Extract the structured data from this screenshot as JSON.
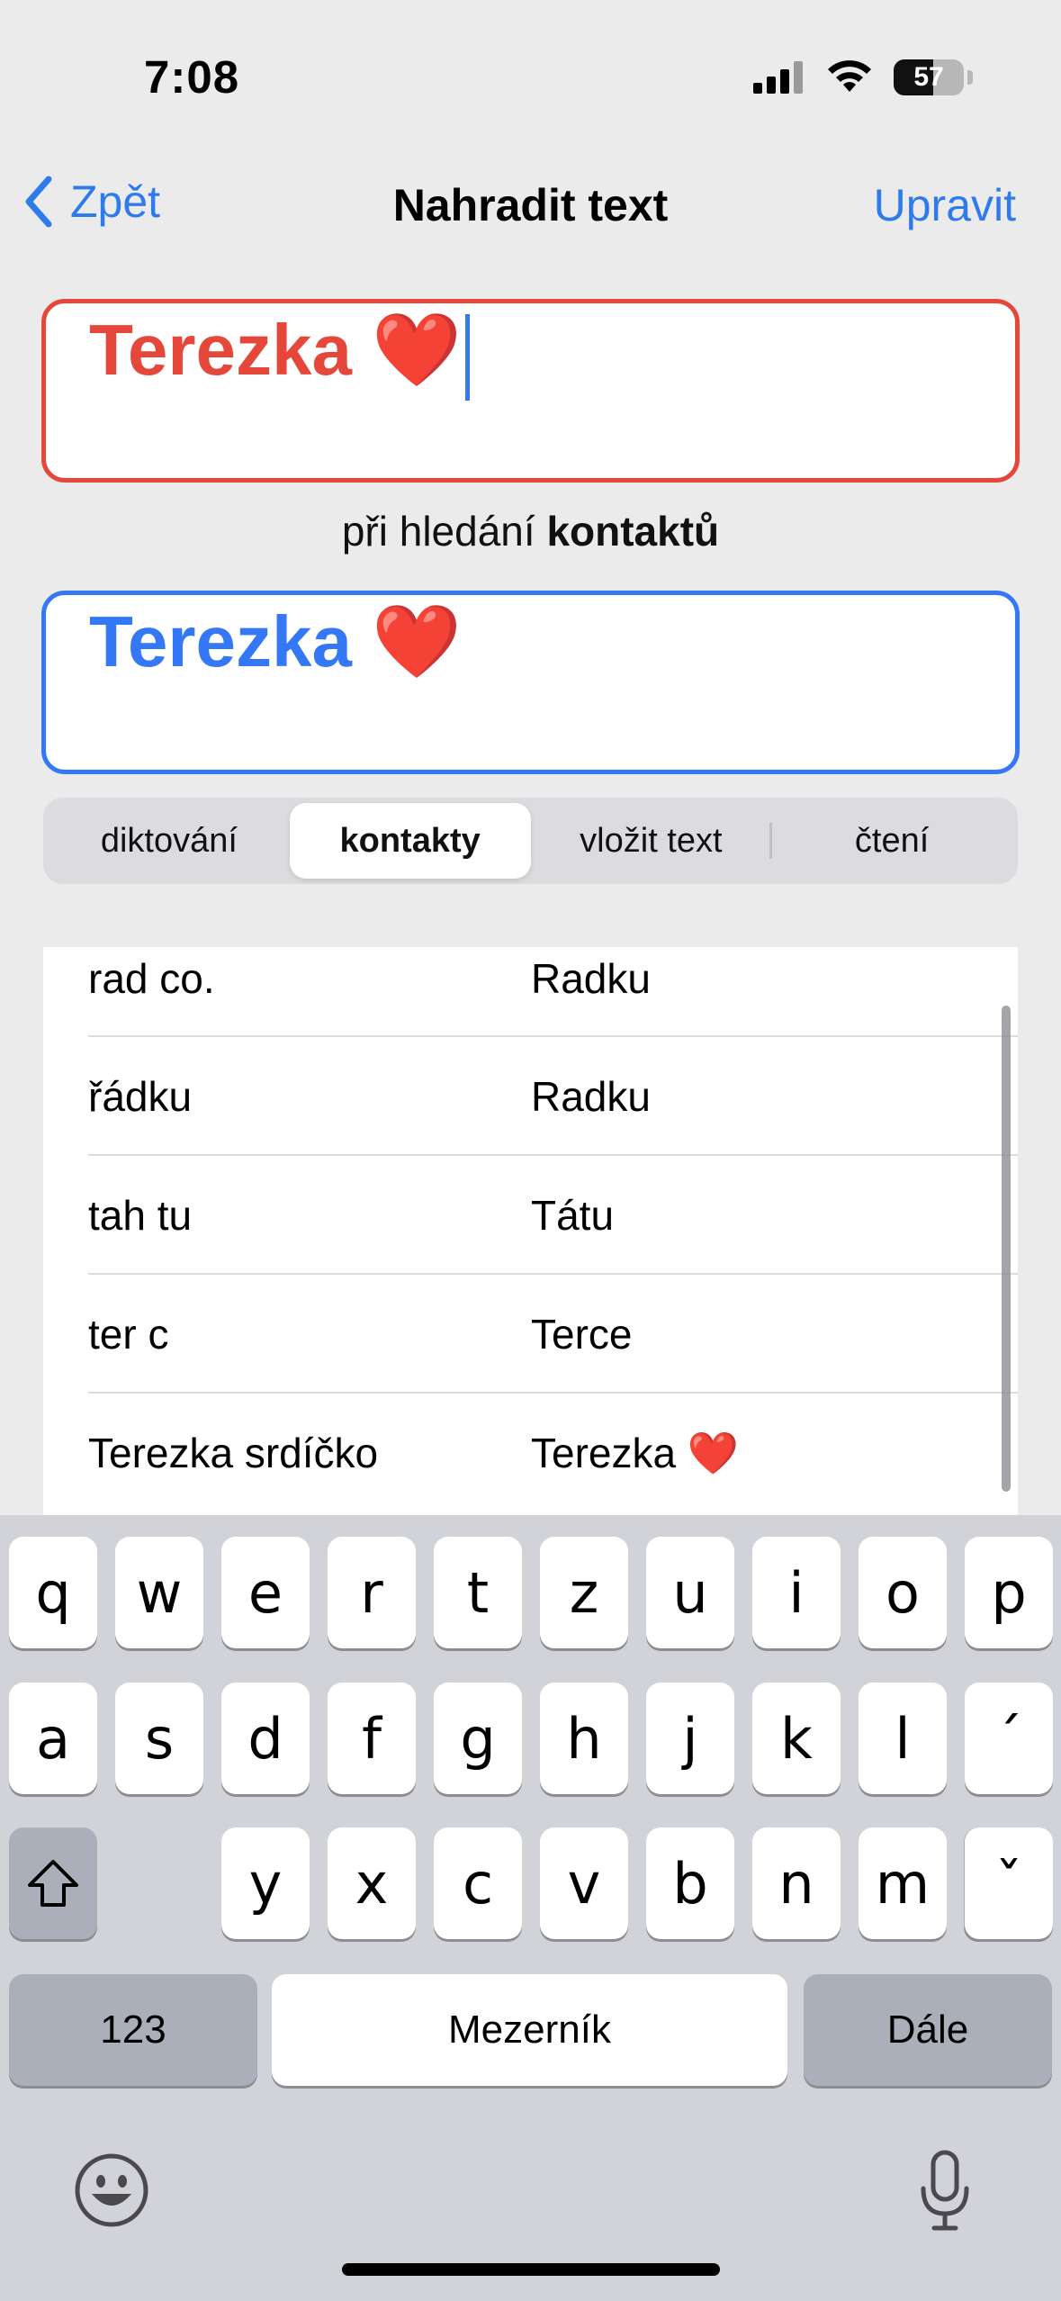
{
  "status_bar": {
    "time": "7:08",
    "battery_level": "57",
    "icons": [
      "cellular-signal-icon",
      "wifi-icon",
      "battery-icon"
    ]
  },
  "nav": {
    "back_label": "Zpět",
    "title": "Nahradit text",
    "edit_label": "Upravit"
  },
  "replacement_field": {
    "value": "Terezka ❤️",
    "color": "#E5483B"
  },
  "context": {
    "prefix": "při hledání ",
    "bold": "kontaktů"
  },
  "original_field": {
    "value": "Terezka ❤️",
    "color": "#3478F6"
  },
  "segments": [
    {
      "label": "diktování",
      "active": false
    },
    {
      "label": "kontakty",
      "active": true
    },
    {
      "label": "vložit text",
      "active": false
    },
    {
      "label": "čtení",
      "active": false
    }
  ],
  "rows": [
    {
      "phrase": "rad co.",
      "replacement": "Radku"
    },
    {
      "phrase": "řádku",
      "replacement": "Radku"
    },
    {
      "phrase": "tah tu",
      "replacement": "Tátu"
    },
    {
      "phrase": "ter c",
      "replacement": "Terce"
    },
    {
      "phrase": "Terezka srdíčko",
      "replacement": "Terezka ❤️"
    }
  ],
  "keyboard": {
    "row1": [
      "q",
      "w",
      "e",
      "r",
      "t",
      "z",
      "u",
      "i",
      "o",
      "p"
    ],
    "row2": [
      "a",
      "s",
      "d",
      "f",
      "g",
      "h",
      "j",
      "k",
      "l",
      "´"
    ],
    "row3": [
      "y",
      "x",
      "c",
      "v",
      "b",
      "n",
      "m",
      "ˇ"
    ],
    "numbers_label": "123",
    "space_label": "Mezerník",
    "return_label": "Dále",
    "bottom_icons": [
      "emoji-icon",
      "microphone-icon"
    ]
  },
  "colors": {
    "accent": "#2F7BEB",
    "red": "#E5483B",
    "blue": "#3478F6"
  }
}
